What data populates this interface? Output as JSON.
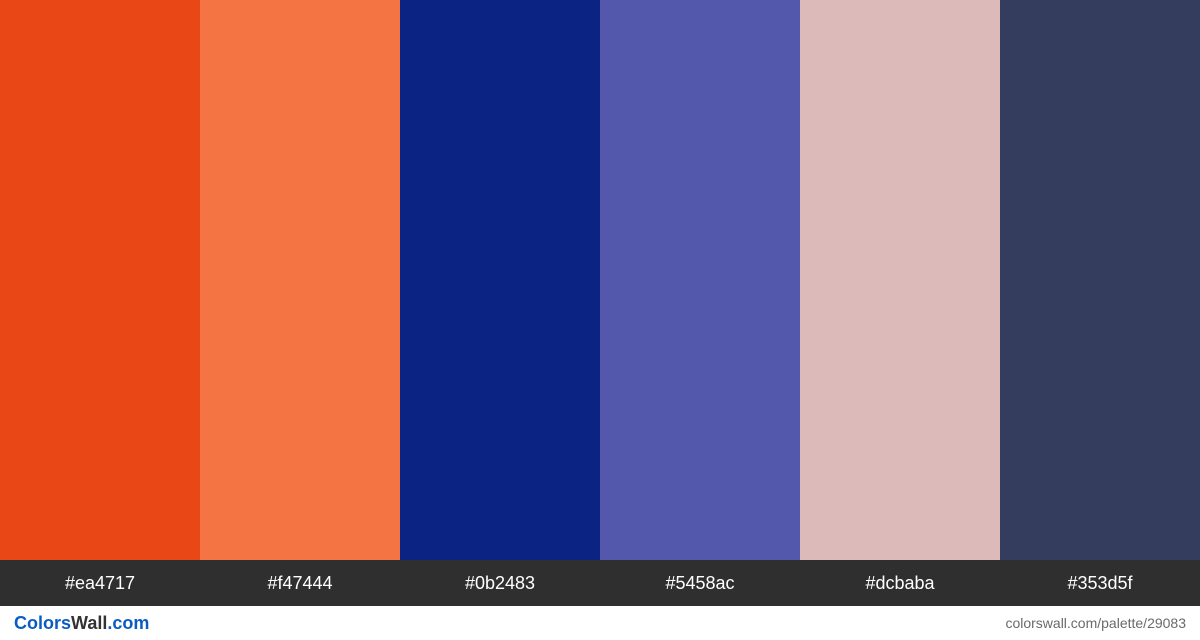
{
  "palette": {
    "colors": [
      {
        "hex": "#ea4717"
      },
      {
        "hex": "#f47444"
      },
      {
        "hex": "#0b2483"
      },
      {
        "hex": "#5458ac"
      },
      {
        "hex": "#dcbaba"
      },
      {
        "hex": "#353d5f"
      }
    ]
  },
  "brand": {
    "part1": "Colors",
    "part2": "Wall",
    "suffix": ".com"
  },
  "permalink": "colorswall.com/palette/29083"
}
